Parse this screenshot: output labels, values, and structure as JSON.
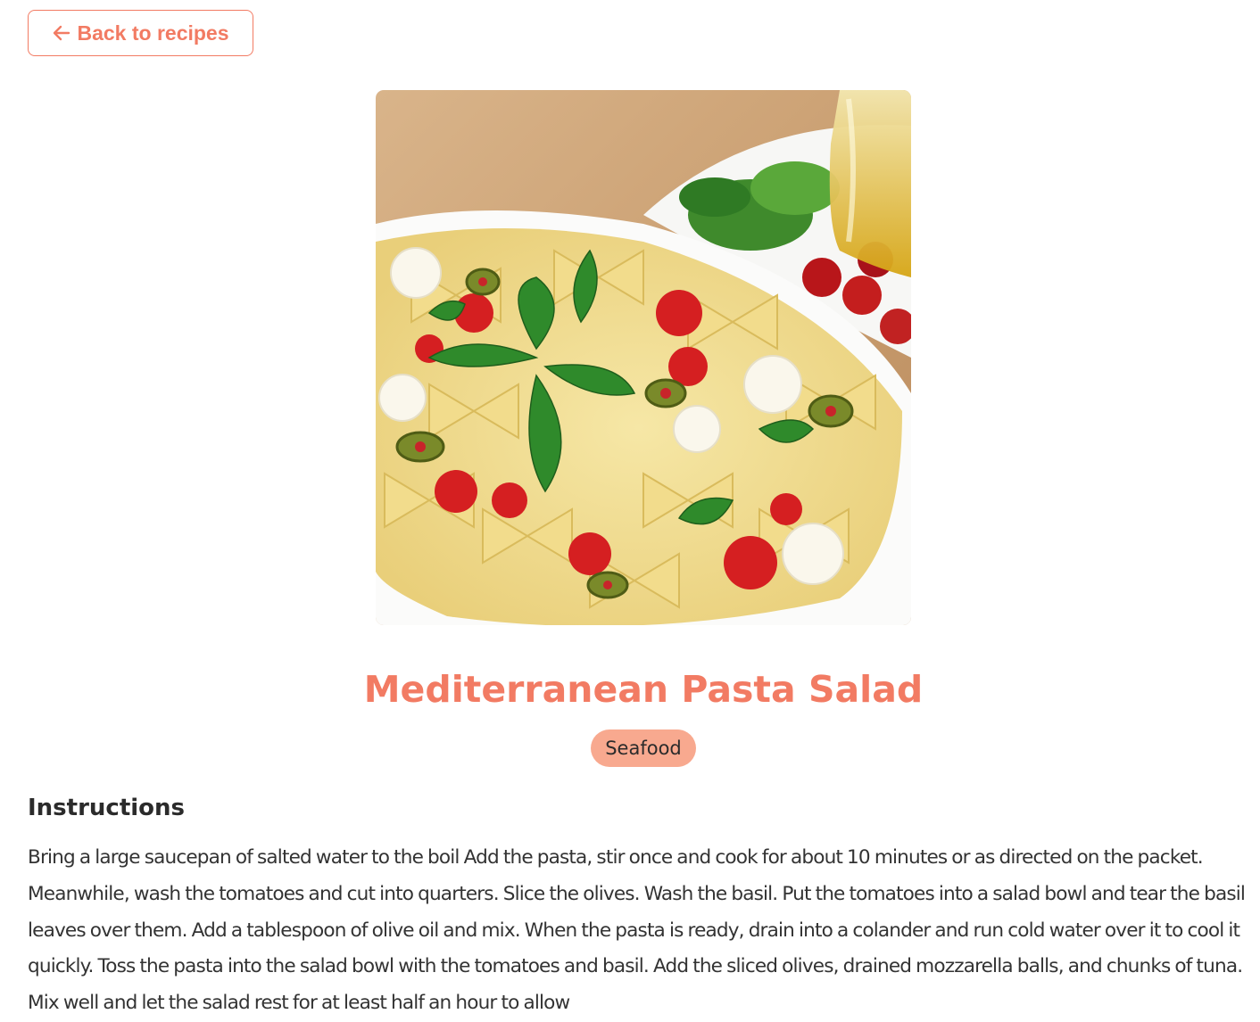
{
  "nav": {
    "back_label": "Back to recipes",
    "back_icon": "arrow-left-icon"
  },
  "recipe": {
    "image_alt": "Mediterranean Pasta Salad",
    "title": "Mediterranean Pasta Salad",
    "category": "Seafood",
    "instructions_heading": "Instructions",
    "instructions": "Bring a large saucepan of salted water to the boil Add the pasta, stir once and cook for about 10 minutes or as directed on the packet. Meanwhile, wash the tomatoes and cut into quarters. Slice the olives. Wash the basil. Put the tomatoes into a salad bowl and tear the basil leaves over them. Add a tablespoon of olive oil and mix. When the pasta is ready, drain into a colander and run cold water over it to cool it quickly. Toss the pasta into the salad bowl with the tomatoes and basil. Add the sliced olives, drained mozzarella balls, and chunks of tuna. Mix well and let the salad rest for at least half an hour to allow"
  },
  "colors": {
    "accent": "#f27b63",
    "badge_bg": "#f8a98f",
    "text": "#2b2b2b"
  }
}
